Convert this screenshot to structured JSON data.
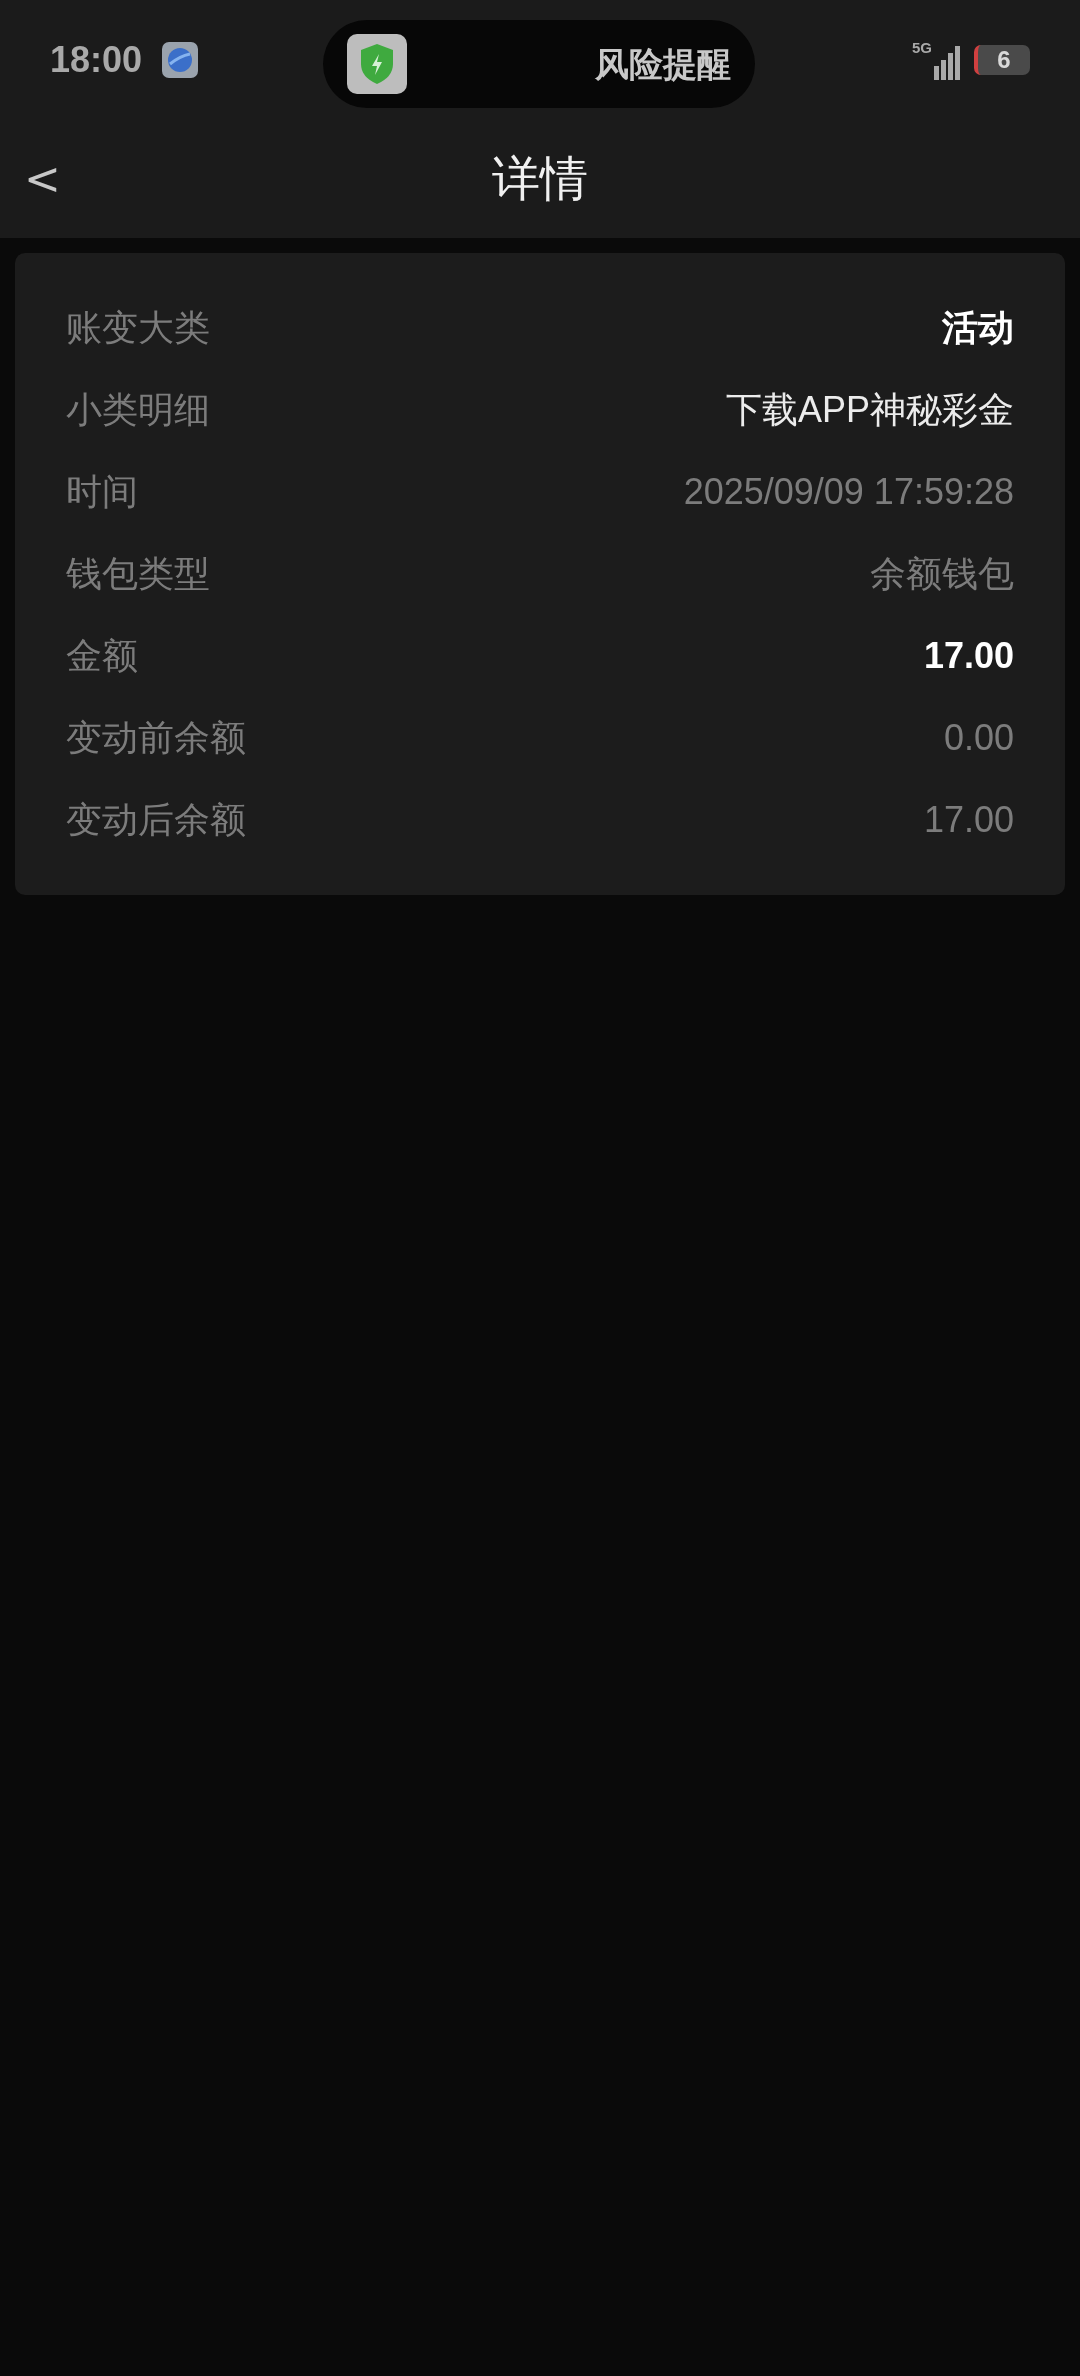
{
  "status_bar": {
    "time": "18:00",
    "alert": "风险提醒",
    "network": "5G",
    "battery": "6"
  },
  "header": {
    "back": "<",
    "title": "详情"
  },
  "details": [
    {
      "label": "账变大类",
      "value": "活动",
      "kind": "strong"
    },
    {
      "label": "小类明细",
      "value": "下载APP神秘彩金",
      "kind": "plain"
    },
    {
      "label": "时间",
      "value": "2025/09/09 17:59:28",
      "kind": "muted"
    },
    {
      "label": "钱包类型",
      "value": "余额钱包",
      "kind": "muted"
    },
    {
      "label": "金额",
      "value": "17.00",
      "kind": "strong"
    },
    {
      "label": "变动前余额",
      "value": "0.00",
      "kind": "muted"
    },
    {
      "label": "变动后余额",
      "value": "17.00",
      "kind": "muted"
    }
  ]
}
